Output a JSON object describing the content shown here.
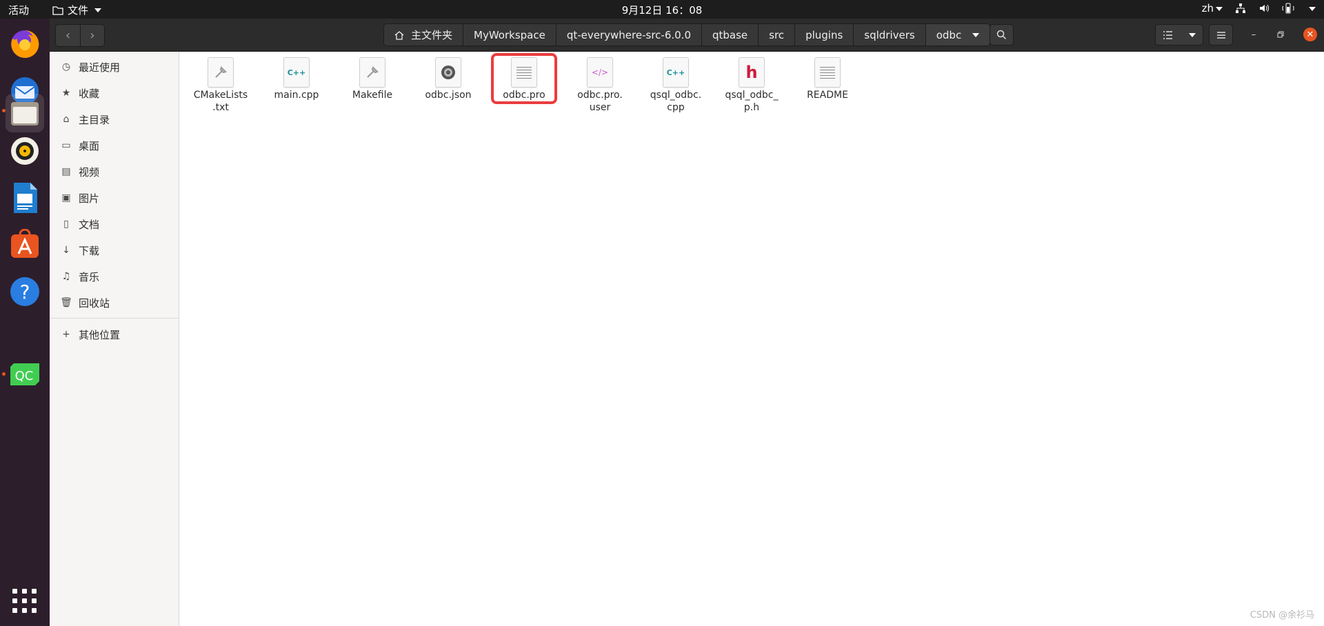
{
  "topbar": {
    "activities": "活动",
    "app_menu": "文件",
    "clock": "9月12日  16：08",
    "lang": "zh"
  },
  "dock": {
    "items": [
      "firefox-icon",
      "thunderbird-icon",
      "files-icon",
      "rhythmbox-icon",
      "writer-icon",
      "software-icon",
      "help-icon",
      "qtcreator-icon"
    ]
  },
  "header": {
    "path": [
      "主文件夹",
      "MyWorkspace",
      "qt-everywhere-src-6.0.0",
      "qtbase",
      "src",
      "plugins",
      "sqldrivers",
      "odbc"
    ]
  },
  "sidebar": {
    "items": [
      {
        "label": "最近使用",
        "icon": "clock-icon"
      },
      {
        "label": "收藏",
        "icon": "star-icon"
      },
      {
        "label": "主目录",
        "icon": "home-icon"
      },
      {
        "label": "桌面",
        "icon": "desktop-icon"
      },
      {
        "label": "视频",
        "icon": "video-icon"
      },
      {
        "label": "图片",
        "icon": "picture-icon"
      },
      {
        "label": "文档",
        "icon": "document-icon"
      },
      {
        "label": "下载",
        "icon": "download-icon"
      },
      {
        "label": "音乐",
        "icon": "music-icon"
      },
      {
        "label": "回收站",
        "icon": "trash-icon"
      }
    ],
    "other": "其他位置"
  },
  "files": [
    {
      "name": "CMakeLists\n.txt",
      "type": "build"
    },
    {
      "name": "main.cpp",
      "type": "cpp"
    },
    {
      "name": "Makefile",
      "type": "build"
    },
    {
      "name": "odbc.json",
      "type": "json"
    },
    {
      "name": "odbc.pro",
      "type": "text",
      "highlighted": true
    },
    {
      "name": "odbc.pro.\nuser",
      "type": "xml"
    },
    {
      "name": "qsql_odbc.\ncpp",
      "type": "cpp"
    },
    {
      "name": "qsql_odbc_\np.h",
      "type": "header"
    },
    {
      "name": "README",
      "type": "text"
    }
  ],
  "watermark": "CSDN @余衫马",
  "colors": {
    "accent": "#e95420",
    "highlight": "#ea3d3d",
    "dock": "#2d1e2b"
  }
}
